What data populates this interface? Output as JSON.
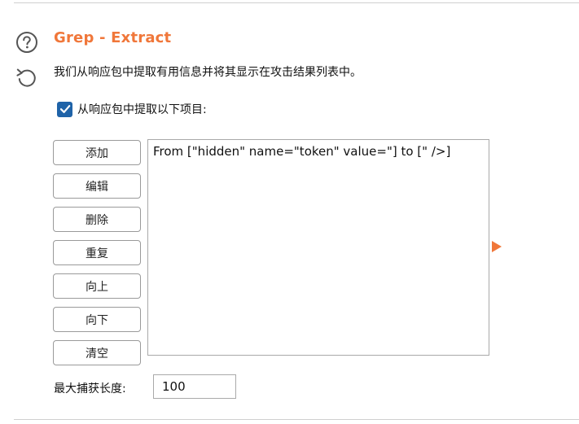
{
  "section": {
    "title": "Grep - Extract",
    "description": "我们从响应包中提取有用信息并将其显示在攻击结果列表中。",
    "help_icon": "help-circle-icon",
    "reset_icon": "reset-arrow-icon"
  },
  "extract_option": {
    "checked": true,
    "label": "从响应包中提取以下项目:"
  },
  "buttons": {
    "add": "添加",
    "edit": "编辑",
    "delete": "删除",
    "duplicate": "重复",
    "up": "向上",
    "down": "向下",
    "clear": "清空"
  },
  "extract_items": [
    "From [\"hidden\" name=\"token\" value=\"] to [\" />]"
  ],
  "max_capture": {
    "label": "最大捕获长度:",
    "value": "100"
  },
  "colors": {
    "accent": "#f0773a",
    "checkbox": "#1f63a8"
  }
}
